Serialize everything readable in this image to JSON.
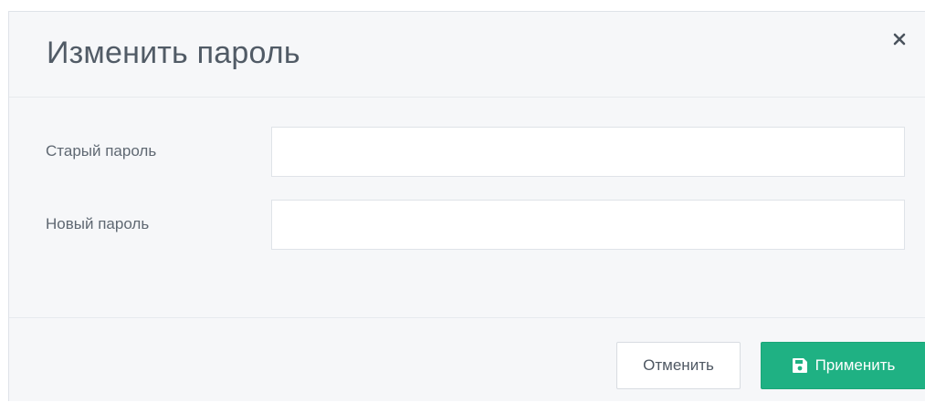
{
  "dialog": {
    "title": "Изменить пароль",
    "close_icon": "close-icon"
  },
  "form": {
    "fields": [
      {
        "label": "Старый пароль",
        "value": "",
        "placeholder": ""
      },
      {
        "label": "Новый пароль",
        "value": "",
        "placeholder": ""
      }
    ]
  },
  "footer": {
    "cancel_label": "Отменить",
    "apply_label": "Применить",
    "apply_icon": "save-icon"
  },
  "colors": {
    "accent": "#1fb183",
    "title_text": "#515b66",
    "label_text": "#5f6872",
    "dialog_background": "#f6f7f9"
  }
}
